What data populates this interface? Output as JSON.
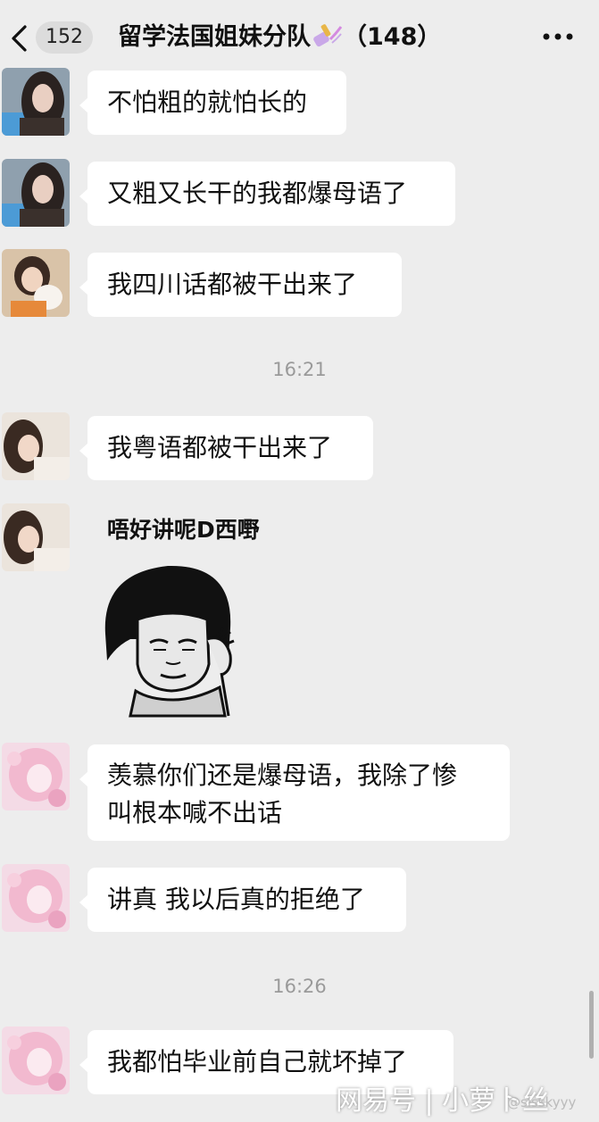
{
  "header": {
    "unread_count": "152",
    "title": "留学法国姐妹分队",
    "member_count": "（148）"
  },
  "messages": [
    {
      "text": "不怕粗的就怕长的"
    },
    {
      "text": "又粗又长干的我都爆母语了"
    },
    {
      "text": "我四川话都被干出来了"
    },
    {
      "text": "我粤语都被干出来了"
    },
    {
      "text": "唔好讲呢D西嘢"
    },
    {
      "text": "羡慕你们还是爆母语，我除了惨\n叫根本喊不出话"
    },
    {
      "text": "讲真 我以后真的拒绝了"
    },
    {
      "text": "我都怕毕业前自己就坏掉了"
    }
  ],
  "timestamps": [
    "16:21",
    "16:26"
  ],
  "watermark": {
    "main": "网易号 | 小萝卜丝",
    "small": "@sisskyyy"
  },
  "icons": {
    "back": "chevron-left-icon",
    "more": "more-dots-icon",
    "title_emoji": "nail-polish-emoji-icon"
  },
  "colors": {
    "background": "#ededed",
    "bubble": "#ffffff",
    "timestamp": "#9a9a9a"
  }
}
